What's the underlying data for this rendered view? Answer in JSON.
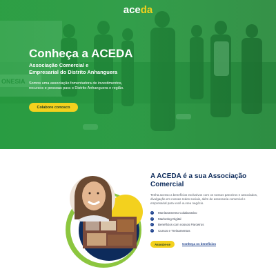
{
  "logo": {
    "letters": [
      "a",
      "c",
      "e",
      "d",
      "a"
    ],
    "label": "aceda"
  },
  "hero": {
    "title": "Conheça a ACEDA",
    "subtitle_line1": "Associação Comercial e",
    "subtitle_line2": "Empresarial do Distrito Anhanguera",
    "description": "Somos uma associação fomentadora de investimentos, recursos e pessoas para o Distrito Anhanguera e região.",
    "cta_label": "Colabore conosco"
  },
  "about": {
    "title_line1": "A ACEDA é a sua Associação",
    "title_line2": "Comercial",
    "description": "Tenha acesso a benefícios exclusivos com os nossos parceiros e associados, divulgação em nossas redes sociais, além de assessoria comercial e empresarial para você ou seu negócio.",
    "benefits": [
      "Monitoramento Colaborativo",
      "Marketing Digital",
      "Benefícios com nossos Parceiros",
      "Cursos e Treinamentos"
    ],
    "primary_button": "Associe-se",
    "secondary_link": "Conheça os benefícios"
  },
  "colors": {
    "hero_green": "#21a040",
    "accent_yellow": "#f3d11e",
    "navy": "#0d2b5b",
    "blue": "#1b3f8c",
    "light_green": "#8cc63f"
  },
  "icons": {
    "benefit_check": "check-circle-icon"
  }
}
